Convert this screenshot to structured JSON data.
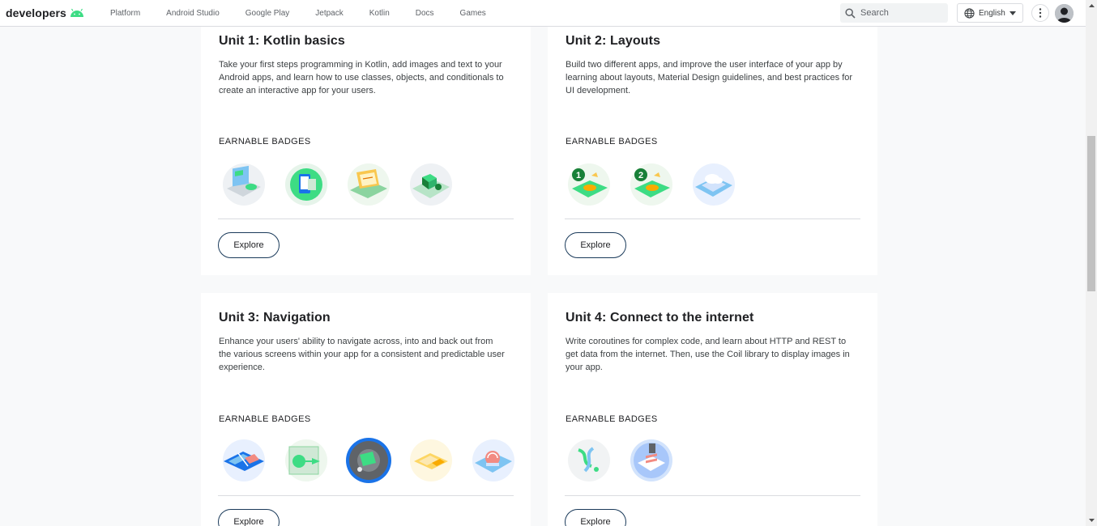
{
  "header": {
    "brand": "developers",
    "nav": [
      "Platform",
      "Android Studio",
      "Google Play",
      "Jetpack",
      "Kotlin",
      "Docs",
      "Games"
    ],
    "search_placeholder": "Search",
    "language": "English"
  },
  "units": [
    {
      "title": "Unit 1: Kotlin basics",
      "description": "Take your first steps programming in Kotlin, add images and text to your Android apps, and learn how to use classes, objects, and conditionals to create an interactive app for your users.",
      "badges_label": "EARNABLE BADGES",
      "badge_count": 4,
      "explore_label": "Explore"
    },
    {
      "title": "Unit 2: Layouts",
      "description": "Build two different apps, and improve the user interface of your app by learning about layouts, Material Design guidelines, and best practices for UI development.",
      "badges_label": "EARNABLE BADGES",
      "badge_count": 3,
      "explore_label": "Explore"
    },
    {
      "title": "Unit 3: Navigation",
      "description": "Enhance your users' ability to navigate across, into and back out from the various screens within your app for a consistent and predictable user experience.",
      "badges_label": "EARNABLE BADGES",
      "badge_count": 5,
      "explore_label": "Explore"
    },
    {
      "title": "Unit 4: Connect to the internet",
      "description": "Write coroutines for complex code, and learn about HTTP and REST to get data from the internet. Then, use the Coil library to display images in your app.",
      "badges_label": "EARNABLE BADGES",
      "badge_count": 2,
      "explore_label": "Explore"
    }
  ],
  "colors": {
    "android_green": "#3ddc84",
    "button_border": "#1a3a5a",
    "page_bg": "#f8f9fa"
  }
}
